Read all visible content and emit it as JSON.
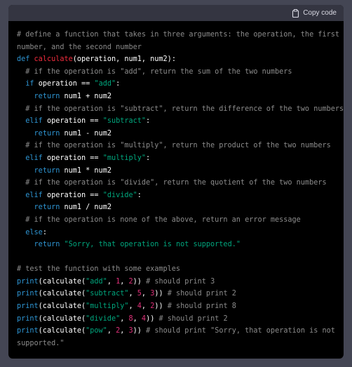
{
  "header": {
    "copy_label": "Copy code",
    "copy_icon": "clipboard-icon"
  },
  "colors": {
    "background": "#444654",
    "code_bg": "#000000",
    "header_bg": "#343541",
    "comment": "#8b8b8b",
    "keyword": "#2e95d3",
    "function_name": "#f22c3d",
    "string": "#00a67d",
    "number": "#df3079",
    "text": "#ffffff"
  },
  "code": {
    "lines": [
      [
        {
          "t": "c",
          "v": "# define a function that takes in three arguments: the operation, the first"
        }
      ],
      [
        {
          "t": "c",
          "v": "number, and the second number"
        }
      ],
      [
        {
          "t": "k",
          "v": "def "
        },
        {
          "t": "f",
          "v": "calculate"
        },
        {
          "t": "p",
          "v": "(operation, num1, num2):"
        }
      ],
      [
        {
          "t": "c",
          "v": "  # if the operation is \"add\", return the sum of the two numbers"
        }
      ],
      [
        {
          "t": "p",
          "v": "  "
        },
        {
          "t": "k",
          "v": "if"
        },
        {
          "t": "p",
          "v": " operation == "
        },
        {
          "t": "s",
          "v": "\"add\""
        },
        {
          "t": "p",
          "v": ":"
        }
      ],
      [
        {
          "t": "p",
          "v": "    "
        },
        {
          "t": "k",
          "v": "return"
        },
        {
          "t": "p",
          "v": " num1 + num2"
        }
      ],
      [
        {
          "t": "c",
          "v": "  # if the operation is \"subtract\", return the difference of the two numbers"
        }
      ],
      [
        {
          "t": "p",
          "v": "  "
        },
        {
          "t": "k",
          "v": "elif"
        },
        {
          "t": "p",
          "v": " operation == "
        },
        {
          "t": "s",
          "v": "\"subtract\""
        },
        {
          "t": "p",
          "v": ":"
        }
      ],
      [
        {
          "t": "p",
          "v": "    "
        },
        {
          "t": "k",
          "v": "return"
        },
        {
          "t": "p",
          "v": " num1 - num2"
        }
      ],
      [
        {
          "t": "c",
          "v": "  # if the operation is \"multiply\", return the product of the two numbers"
        }
      ],
      [
        {
          "t": "p",
          "v": "  "
        },
        {
          "t": "k",
          "v": "elif"
        },
        {
          "t": "p",
          "v": " operation == "
        },
        {
          "t": "s",
          "v": "\"multiply\""
        },
        {
          "t": "p",
          "v": ":"
        }
      ],
      [
        {
          "t": "p",
          "v": "    "
        },
        {
          "t": "k",
          "v": "return"
        },
        {
          "t": "p",
          "v": " num1 * num2"
        }
      ],
      [
        {
          "t": "c",
          "v": "  # if the operation is \"divide\", return the quotient of the two numbers"
        }
      ],
      [
        {
          "t": "p",
          "v": "  "
        },
        {
          "t": "k",
          "v": "elif"
        },
        {
          "t": "p",
          "v": " operation == "
        },
        {
          "t": "s",
          "v": "\"divide\""
        },
        {
          "t": "p",
          "v": ":"
        }
      ],
      [
        {
          "t": "p",
          "v": "    "
        },
        {
          "t": "k",
          "v": "return"
        },
        {
          "t": "p",
          "v": " num1 / num2"
        }
      ],
      [
        {
          "t": "c",
          "v": "  # if the operation is none of the above, return an error message"
        }
      ],
      [
        {
          "t": "p",
          "v": "  "
        },
        {
          "t": "k",
          "v": "else"
        },
        {
          "t": "p",
          "v": ":"
        }
      ],
      [
        {
          "t": "p",
          "v": "    "
        },
        {
          "t": "k",
          "v": "return"
        },
        {
          "t": "p",
          "v": " "
        },
        {
          "t": "s",
          "v": "\"Sorry, that operation is not supported.\""
        }
      ],
      [],
      [
        {
          "t": "c",
          "v": "# test the function with some examples"
        }
      ],
      [
        {
          "t": "k",
          "v": "print"
        },
        {
          "t": "p",
          "v": "(calculate("
        },
        {
          "t": "s",
          "v": "\"add\""
        },
        {
          "t": "p",
          "v": ", "
        },
        {
          "t": "n",
          "v": "1"
        },
        {
          "t": "p",
          "v": ", "
        },
        {
          "t": "n",
          "v": "2"
        },
        {
          "t": "p",
          "v": ")) "
        },
        {
          "t": "c",
          "v": "# should print 3"
        }
      ],
      [
        {
          "t": "k",
          "v": "print"
        },
        {
          "t": "p",
          "v": "(calculate("
        },
        {
          "t": "s",
          "v": "\"subtract\""
        },
        {
          "t": "p",
          "v": ", "
        },
        {
          "t": "n",
          "v": "5"
        },
        {
          "t": "p",
          "v": ", "
        },
        {
          "t": "n",
          "v": "3"
        },
        {
          "t": "p",
          "v": ")) "
        },
        {
          "t": "c",
          "v": "# should print 2"
        }
      ],
      [
        {
          "t": "k",
          "v": "print"
        },
        {
          "t": "p",
          "v": "(calculate("
        },
        {
          "t": "s",
          "v": "\"multiply\""
        },
        {
          "t": "p",
          "v": ", "
        },
        {
          "t": "n",
          "v": "4"
        },
        {
          "t": "p",
          "v": ", "
        },
        {
          "t": "n",
          "v": "2"
        },
        {
          "t": "p",
          "v": ")) "
        },
        {
          "t": "c",
          "v": "# should print 8"
        }
      ],
      [
        {
          "t": "k",
          "v": "print"
        },
        {
          "t": "p",
          "v": "(calculate("
        },
        {
          "t": "s",
          "v": "\"divide\""
        },
        {
          "t": "p",
          "v": ", "
        },
        {
          "t": "n",
          "v": "8"
        },
        {
          "t": "p",
          "v": ", "
        },
        {
          "t": "n",
          "v": "4"
        },
        {
          "t": "p",
          "v": ")) "
        },
        {
          "t": "c",
          "v": "# should print 2"
        }
      ],
      [
        {
          "t": "k",
          "v": "print"
        },
        {
          "t": "p",
          "v": "(calculate("
        },
        {
          "t": "s",
          "v": "\"pow\""
        },
        {
          "t": "p",
          "v": ", "
        },
        {
          "t": "n",
          "v": "2"
        },
        {
          "t": "p",
          "v": ", "
        },
        {
          "t": "n",
          "v": "3"
        },
        {
          "t": "p",
          "v": ")) "
        },
        {
          "t": "c",
          "v": "# should print \"Sorry, that operation is not"
        }
      ],
      [
        {
          "t": "c",
          "v": "supported.\""
        }
      ]
    ]
  }
}
